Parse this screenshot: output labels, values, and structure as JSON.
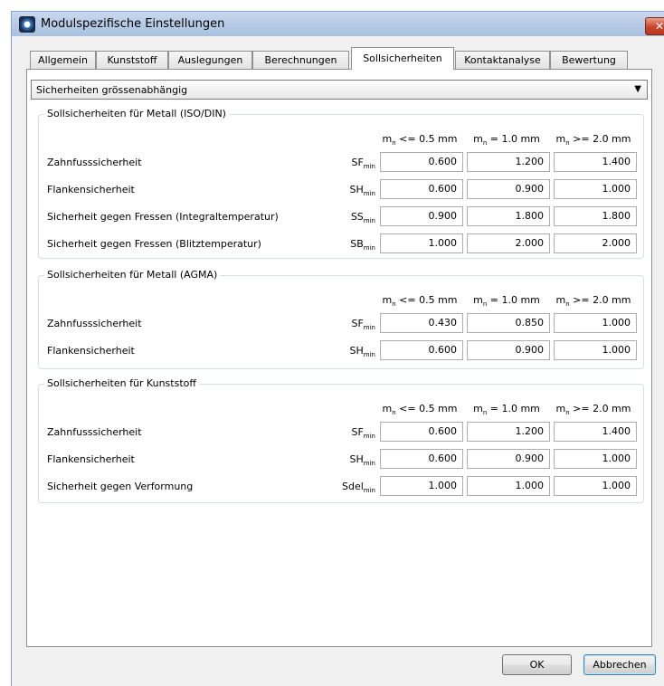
{
  "window": {
    "title": "Modulspezifische Einstellungen",
    "close_glyph": "✕"
  },
  "tabs": [
    {
      "label": "Allgemein",
      "active": false
    },
    {
      "label": "Kunststoff",
      "active": false
    },
    {
      "label": "Auslegungen",
      "active": false
    },
    {
      "label": "Berechnungen",
      "active": false
    },
    {
      "label": "Sollsicherheiten",
      "active": true
    },
    {
      "label": "Kontaktanalyse",
      "active": false
    },
    {
      "label": "Bewertung",
      "active": false
    }
  ],
  "dropdown": {
    "value": "Sicherheiten grössenabhängig",
    "arrow": "▼"
  },
  "columns": {
    "c1": {
      "m": "m",
      "sub": "n",
      "rest": " <= 0.5 mm"
    },
    "c2": {
      "m": "m",
      "sub": "n",
      "rest": " = 1.0 mm"
    },
    "c3": {
      "m": "m",
      "sub": "n",
      "rest": " >= 2.0 mm"
    }
  },
  "groups": {
    "iso": {
      "title": "Sollsicherheiten für Metall (ISO/DIN)",
      "rows": [
        {
          "label": "Zahnfusssicherheit",
          "sym": "SF",
          "sub": "min",
          "values": [
            "0.600",
            "1.200",
            "1.400"
          ]
        },
        {
          "label": "Flankensicherheit",
          "sym": "SH",
          "sub": "min",
          "values": [
            "0.600",
            "0.900",
            "1.000"
          ]
        },
        {
          "label": "Sicherheit gegen Fressen (Integraltemperatur)",
          "sym": "SS",
          "sub": "min",
          "values": [
            "0.900",
            "1.800",
            "1.800"
          ]
        },
        {
          "label": "Sicherheit gegen Fressen (Blitztemperatur)",
          "sym": "SB",
          "sub": "min",
          "values": [
            "1.000",
            "2.000",
            "2.000"
          ]
        }
      ]
    },
    "agma": {
      "title": "Sollsicherheiten für Metall (AGMA)",
      "rows": [
        {
          "label": "Zahnfusssicherheit",
          "sym": "SF",
          "sub": "min",
          "values": [
            "0.430",
            "0.850",
            "1.000"
          ]
        },
        {
          "label": "Flankensicherheit",
          "sym": "SH",
          "sub": "min",
          "values": [
            "0.600",
            "0.900",
            "1.000"
          ]
        }
      ]
    },
    "plastic": {
      "title": "Sollsicherheiten für Kunststoff",
      "rows": [
        {
          "label": "Zahnfusssicherheit",
          "sym": "SF",
          "sub": "min",
          "values": [
            "0.600",
            "1.200",
            "1.400"
          ]
        },
        {
          "label": "Flankensicherheit",
          "sym": "SH",
          "sub": "min",
          "values": [
            "0.600",
            "0.900",
            "1.000"
          ]
        },
        {
          "label": "Sicherheit gegen Verformung",
          "sym": "Sdel",
          "sub": "min",
          "values": [
            "1.000",
            "1.000",
            "1.000"
          ]
        }
      ]
    }
  },
  "buttons": {
    "ok": "OK",
    "cancel": "Abbrechen"
  }
}
